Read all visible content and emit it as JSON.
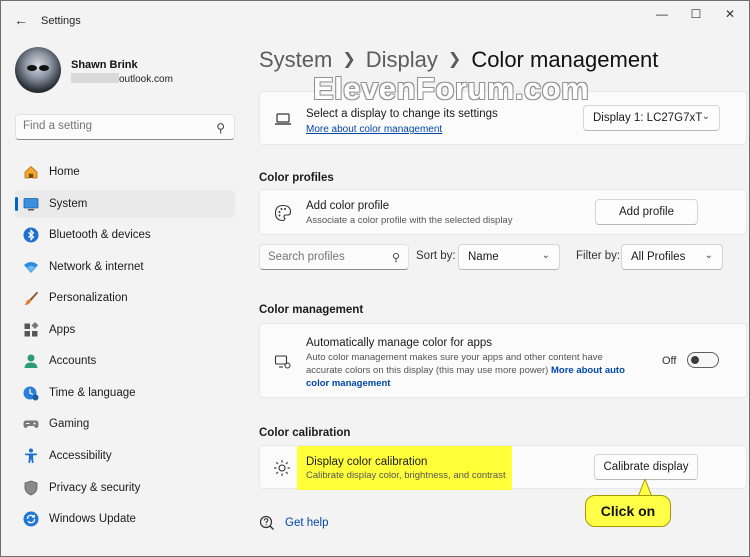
{
  "window": {
    "title": "Settings",
    "watermark": "ElevenForum.com"
  },
  "user": {
    "name": "Shawn Brink",
    "email_visible": "outlook.com"
  },
  "search": {
    "placeholder": "Find a setting"
  },
  "nav": [
    {
      "label": "Home",
      "icon": "home-icon",
      "active": false
    },
    {
      "label": "System",
      "icon": "monitor-icon",
      "active": true
    },
    {
      "label": "Bluetooth & devices",
      "icon": "bluetooth-icon",
      "active": false
    },
    {
      "label": "Network & internet",
      "icon": "wifi-icon",
      "active": false
    },
    {
      "label": "Personalization",
      "icon": "brush-icon",
      "active": false
    },
    {
      "label": "Apps",
      "icon": "apps-icon",
      "active": false
    },
    {
      "label": "Accounts",
      "icon": "person-icon",
      "active": false
    },
    {
      "label": "Time & language",
      "icon": "clock-globe-icon",
      "active": false
    },
    {
      "label": "Gaming",
      "icon": "gamepad-icon",
      "active": false
    },
    {
      "label": "Accessibility",
      "icon": "accessibility-icon",
      "active": false
    },
    {
      "label": "Privacy & security",
      "icon": "shield-icon",
      "active": false
    },
    {
      "label": "Windows Update",
      "icon": "update-icon",
      "active": false
    }
  ],
  "breadcrumb": {
    "parent1": "System",
    "parent2": "Display",
    "current": "Color management"
  },
  "display_select": {
    "title": "Select a display to change its settings",
    "link": "More about color management",
    "value": "Display 1: LC27G7xT"
  },
  "color_profiles": {
    "heading": "Color profiles",
    "add_title": "Add color profile",
    "add_sub": "Associate a color profile with the selected display",
    "add_button": "Add profile",
    "search_placeholder": "Search profiles",
    "sort_label": "Sort by:",
    "sort_value": "Name",
    "filter_label": "Filter by:",
    "filter_value": "All Profiles"
  },
  "color_management": {
    "heading": "Color management",
    "auto_title": "Automatically manage color for apps",
    "auto_sub_1": "Auto color management makes sure your apps and other content have",
    "auto_sub_2": "accurate colors on this display (this may use more power)",
    "auto_link_1": "More about auto",
    "auto_link_2": "color management",
    "toggle_state": "Off"
  },
  "color_calibration": {
    "heading": "Color calibration",
    "title": "Display color calibration",
    "sub": "Calibrate display color, brightness, and contrast",
    "button": "Calibrate display"
  },
  "callout": {
    "text": "Click on"
  },
  "help": {
    "label": "Get help"
  },
  "colors": {
    "accent": "#0067c0",
    "highlight": "#ffff3a",
    "link": "#0047a8"
  }
}
